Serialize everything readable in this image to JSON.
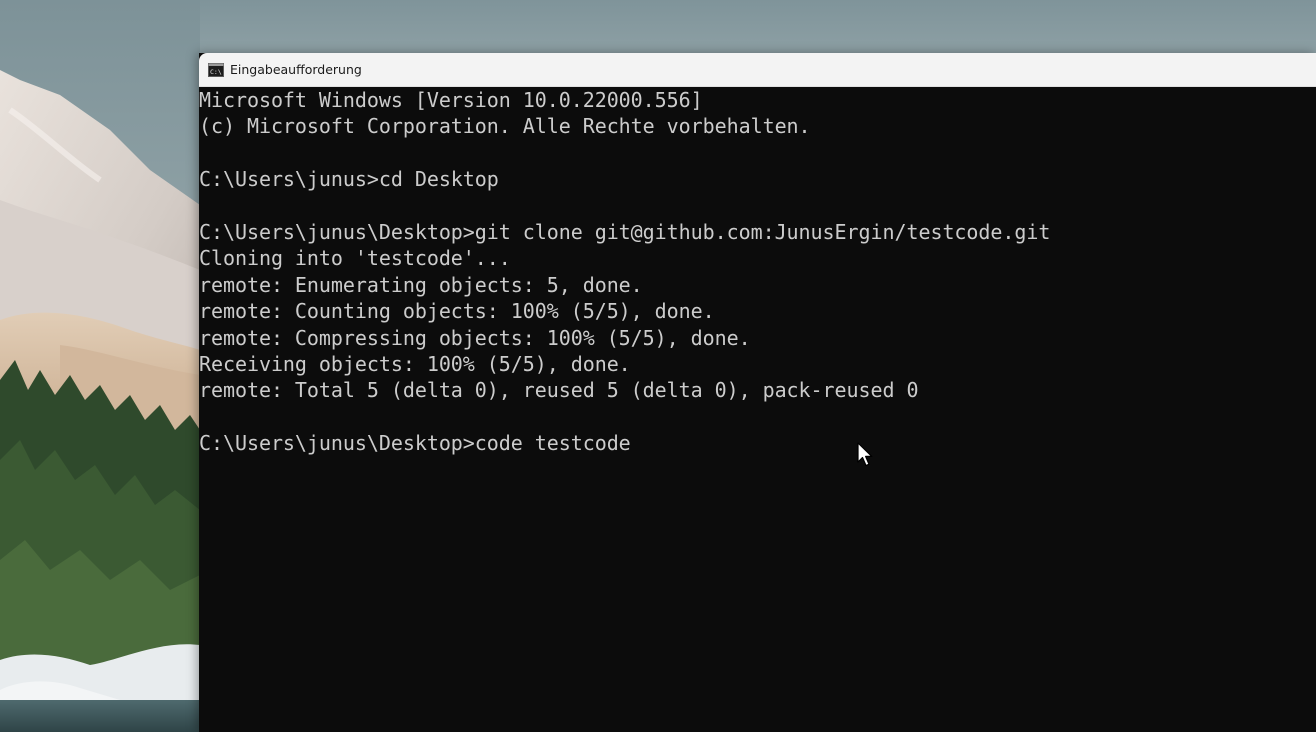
{
  "window": {
    "title": "Eingabeaufforderung",
    "title_icon": "cmd-icon"
  },
  "console": {
    "lines": [
      "Microsoft Windows [Version 10.0.22000.556]",
      "(c) Microsoft Corporation. Alle Rechte vorbehalten.",
      "",
      "C:\\Users\\junus>cd Desktop",
      "",
      "C:\\Users\\junus\\Desktop>git clone git@github.com:JunusErgin/testcode.git",
      "Cloning into 'testcode'...",
      "remote: Enumerating objects: 5, done.",
      "remote: Counting objects: 100% (5/5), done.",
      "remote: Compressing objects: 100% (5/5), done.",
      "Receiving objects: 100% (5/5), done.",
      "remote: Total 5 (delta 0), reused 5 (delta 0), pack-reused 0",
      "",
      "C:\\Users\\junus\\Desktop>code testcode"
    ],
    "background_color": "#0c0c0c",
    "text_color": "#cccccc"
  },
  "desktop": {
    "wallpaper": "windows-11-landscape-wallpaper"
  },
  "pointer": {
    "icon": "mouse-pointer-icon"
  }
}
